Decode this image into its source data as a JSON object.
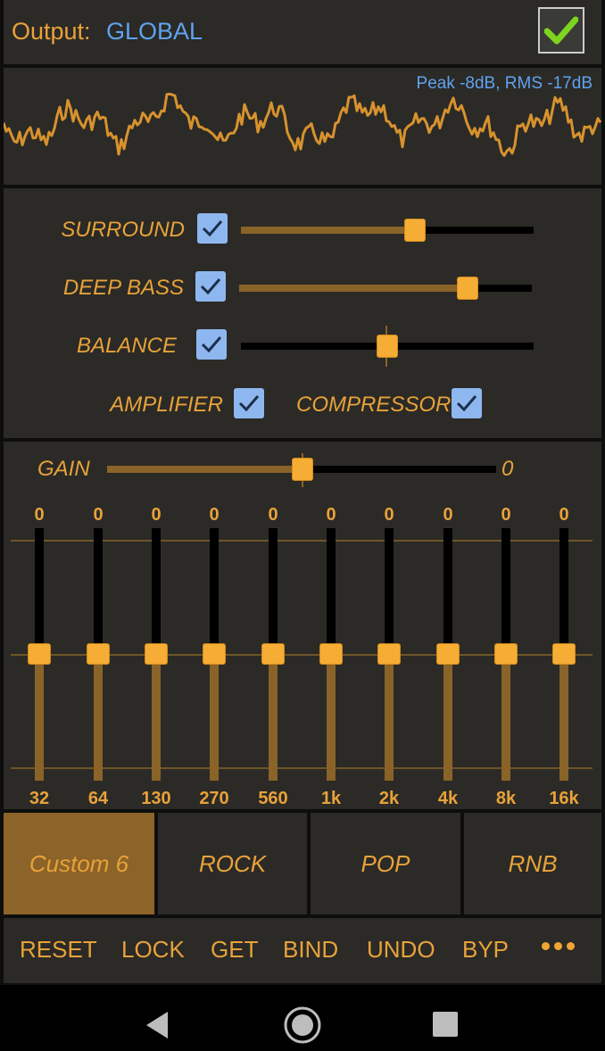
{
  "header": {
    "output_label": "Output:",
    "output_value": "GLOBAL",
    "enabled": true
  },
  "waveform": {
    "stats": "Peak -8dB, RMS -17dB"
  },
  "effects": {
    "surround": {
      "label": "SURROUND",
      "checked": true,
      "level": 0.59
    },
    "deep_bass": {
      "label": "DEEP BASS",
      "checked": true,
      "level": 0.78
    },
    "balance": {
      "label": "BALANCE",
      "checked": true,
      "level": 0.5
    },
    "amplifier": {
      "label": "AMPLIFIER",
      "checked": true
    },
    "compressor": {
      "label": "COMPRESSOR",
      "checked": true
    }
  },
  "gain": {
    "label": "GAIN",
    "value": "0",
    "level": 0.5
  },
  "equalizer": {
    "bands": [
      {
        "freq": "32",
        "value": "0"
      },
      {
        "freq": "64",
        "value": "0"
      },
      {
        "freq": "130",
        "value": "0"
      },
      {
        "freq": "270",
        "value": "0"
      },
      {
        "freq": "560",
        "value": "0"
      },
      {
        "freq": "1k",
        "value": "0"
      },
      {
        "freq": "2k",
        "value": "0"
      },
      {
        "freq": "4k",
        "value": "0"
      },
      {
        "freq": "8k",
        "value": "0"
      },
      {
        "freq": "16k",
        "value": "0"
      }
    ]
  },
  "presets": [
    {
      "label": "Custom 6",
      "active": true
    },
    {
      "label": "ROCK",
      "active": false
    },
    {
      "label": "POP",
      "active": false
    },
    {
      "label": "RNB",
      "active": false
    }
  ],
  "toolbar": {
    "reset": "RESET",
    "lock": "LOCK",
    "get": "GET",
    "bind": "BIND",
    "undo": "UNDO",
    "bypass": "BYP"
  },
  "colors": {
    "accent": "#e8a23a",
    "value_blue": "#5fa2ef",
    "panel": "#2b2a26",
    "active_preset": "#8c6328"
  }
}
